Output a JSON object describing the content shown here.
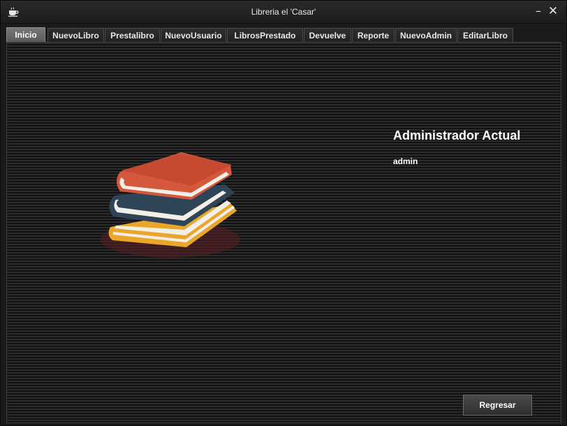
{
  "window": {
    "title": "Libreria el 'Casar'",
    "minimize_glyph": "–",
    "close_glyph": "✕",
    "app_icon": "coffee-cup-icon"
  },
  "tabs": [
    {
      "label": "Inicio",
      "active": true
    },
    {
      "label": "NuevoLibro",
      "active": false
    },
    {
      "label": "Prestalibro",
      "active": false
    },
    {
      "label": "NuevoUsuario",
      "active": false
    },
    {
      "label": "LibrosPrestado",
      "active": false
    },
    {
      "label": "Devuelve",
      "active": false
    },
    {
      "label": "Reporte",
      "active": false
    },
    {
      "label": "NuevoAdmin",
      "active": false
    },
    {
      "label": "EditarLibro",
      "active": false
    }
  ],
  "main": {
    "illustration": "book-stack-icon",
    "admin_heading": "Administrador Actual",
    "admin_name": "admin",
    "back_button": "Regresar"
  },
  "colors": {
    "book_top": "#d4583c",
    "book_middle": "#2f4456",
    "book_bottom": "#e8a72a",
    "pages": "#f3efe6",
    "shadow": "#5a1f1f"
  }
}
